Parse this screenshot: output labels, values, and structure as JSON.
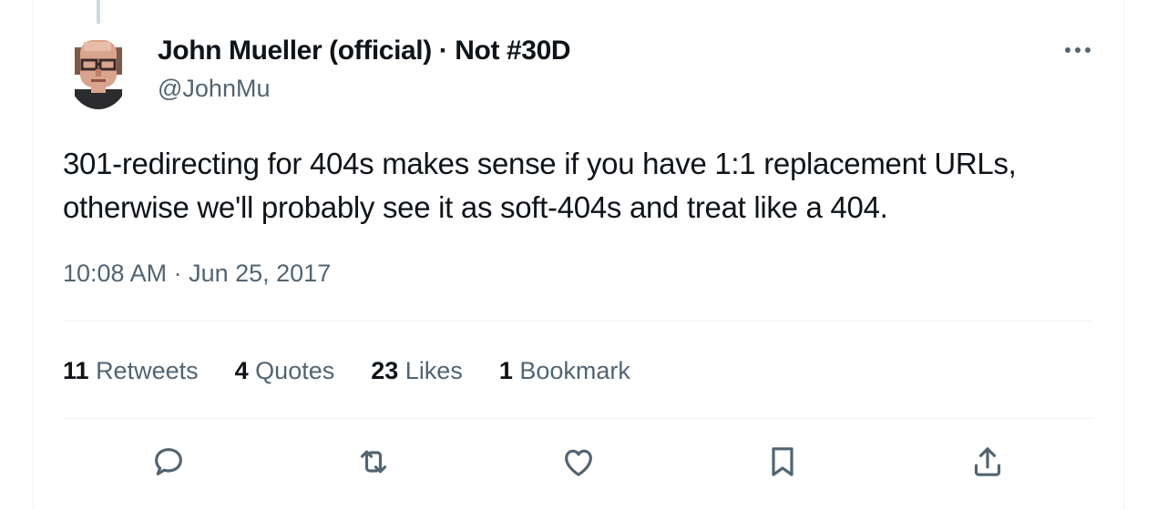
{
  "author": {
    "name": "John Mueller (official) · Not #30D",
    "handle": "@JohnMu",
    "avatar_icon": "pixel-avatar-icon"
  },
  "tweet": {
    "text_lines": [
      "301-redirecting for 404s makes sense if you have 1:1 replacement URLs,",
      "otherwise we'll probably see it as soft-404s and treat like a 404."
    ],
    "timestamp": "10:08 AM · Jun 25, 2017"
  },
  "stats": [
    {
      "count": "11",
      "label": "Retweets"
    },
    {
      "count": "4",
      "label": "Quotes"
    },
    {
      "count": "23",
      "label": "Likes"
    },
    {
      "count": "1",
      "label": "Bookmark"
    }
  ],
  "actions": [
    "reply-icon",
    "retweet-icon",
    "like-icon",
    "bookmark-icon",
    "share-icon"
  ],
  "more_icon": "more-options-icon",
  "colors": {
    "text": "#0f1419",
    "secondary": "#536471",
    "divider": "#eff3f4",
    "icon": "#536471"
  }
}
